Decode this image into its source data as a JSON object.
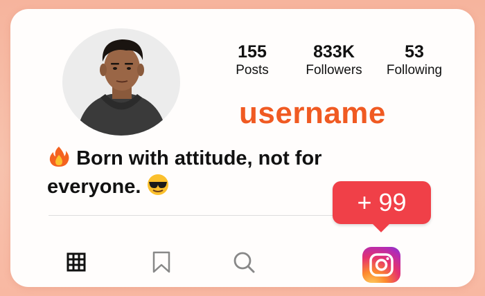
{
  "profile": {
    "stats": [
      {
        "value": "155",
        "label": "Posts"
      },
      {
        "value": "833K",
        "label": "Followers"
      },
      {
        "value": "53",
        "label": "Following"
      }
    ],
    "username": "username",
    "bio_line1": "Born with attitude, not for",
    "bio_line2": "everyone.",
    "bio_emojis": [
      "fire-emoji",
      "sunglasses-emoji"
    ]
  },
  "notification": {
    "badge_text": "+ 99"
  },
  "nav": {
    "items": [
      "grid-icon",
      "bookmark-icon",
      "search-icon",
      "instagram-icon"
    ]
  },
  "colors": {
    "username": "#f05a22",
    "badge": "#f04048",
    "background": "#f6b49d"
  }
}
